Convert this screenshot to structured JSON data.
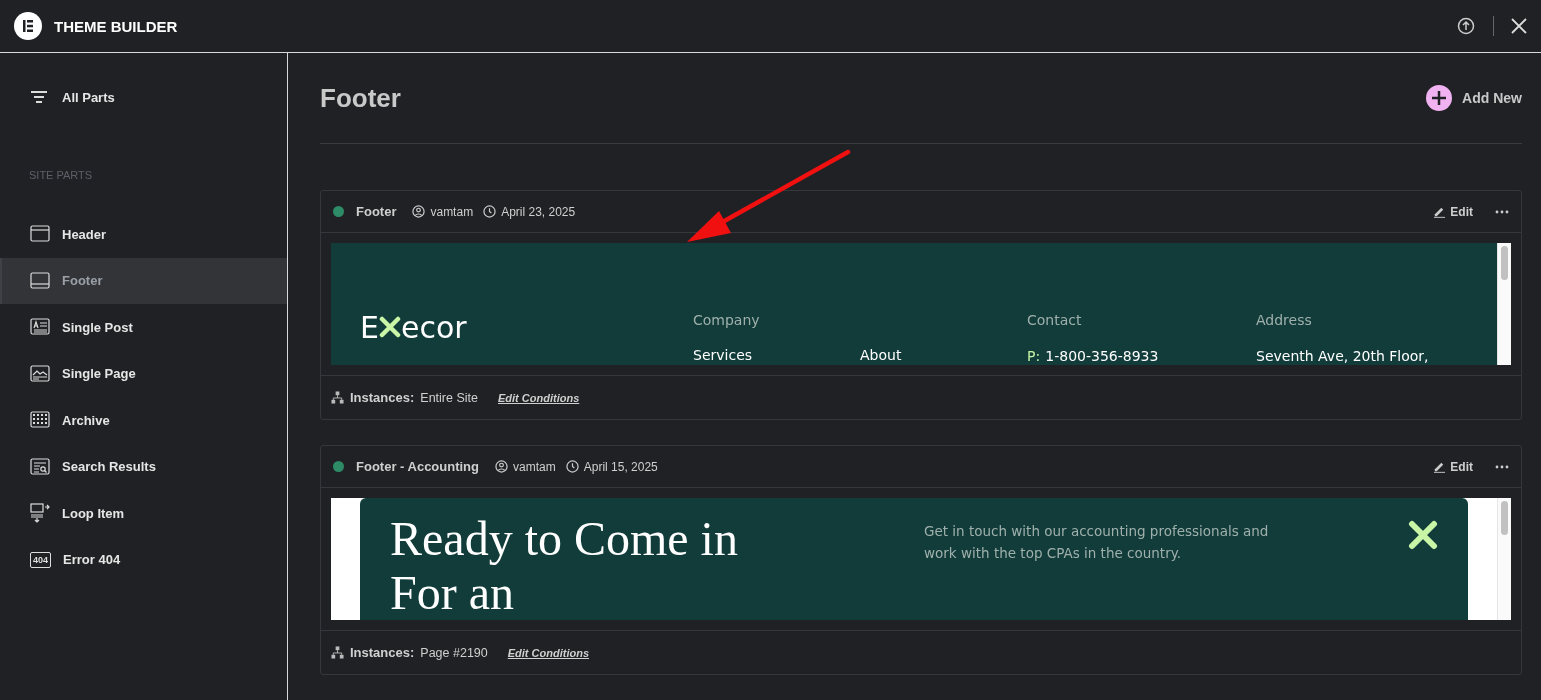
{
  "app": {
    "title": "THEME BUILDER"
  },
  "sidebar": {
    "all_parts": "All Parts",
    "section_label": "SITE PARTS",
    "items": [
      {
        "label": "Header",
        "selected": false
      },
      {
        "label": "Footer",
        "selected": true
      },
      {
        "label": "Single Post",
        "selected": false
      },
      {
        "label": "Single Page",
        "selected": false
      },
      {
        "label": "Archive",
        "selected": false
      },
      {
        "label": "Search Results",
        "selected": false
      },
      {
        "label": "Loop Item",
        "selected": false
      },
      {
        "label": "Error 404",
        "icon_text": "404",
        "selected": false
      }
    ]
  },
  "main": {
    "title": "Footer",
    "add_new": "Add New",
    "annotation": {
      "kind": "arrow"
    }
  },
  "templates": [
    {
      "name": "Footer",
      "color": "#2e8b67",
      "author": "vamtam",
      "date": "April 23, 2025",
      "edit": "Edit",
      "instances_label": "Instances:",
      "instances": "Entire Site",
      "edit_conditions": "Edit Conditions",
      "preview": {
        "kind": "columns",
        "logo_start": "E",
        "logo_end": "ecor",
        "company": {
          "heading": "Company",
          "links": [
            "Services",
            "About"
          ]
        },
        "contact": {
          "heading": "Contact",
          "label": "P:",
          "value": "1-800-356-8933"
        },
        "address": {
          "heading": "Address",
          "line": "Seventh Ave, 20th Floor,"
        }
      }
    },
    {
      "name": "Footer - Accounting",
      "color": "#2e8b67",
      "author": "vamtam",
      "date": "April 15, 2025",
      "edit": "Edit",
      "instances_label": "Instances:",
      "instances": "Page #2190",
      "edit_conditions": "Edit Conditions",
      "preview": {
        "kind": "cta",
        "heading": "Ready to Come in For an",
        "text": "Get in touch with our accounting professionals and work with the top CPAs in the country."
      }
    }
  ]
}
